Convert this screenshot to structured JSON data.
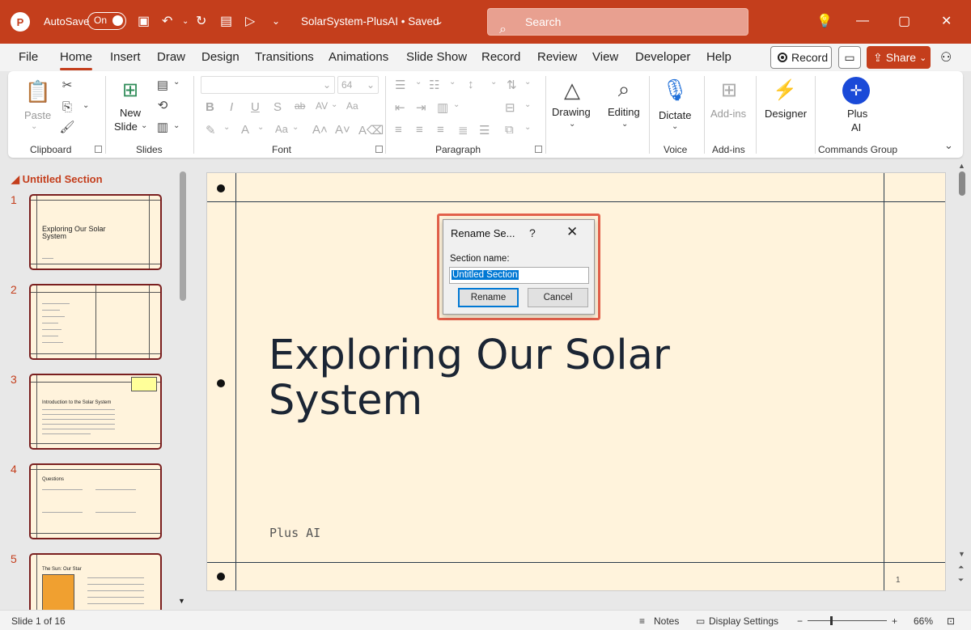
{
  "titlebar": {
    "app_logo": "P",
    "autosave_label": "AutoSave",
    "autosave_state": "On",
    "doc_title": "SolarSystem-PlusAI • Saved",
    "search_placeholder": "Search",
    "accent_color": "#c43e1c"
  },
  "menu": {
    "tabs": [
      "File",
      "Home",
      "Insert",
      "Draw",
      "Design",
      "Transitions",
      "Animations",
      "Slide Show",
      "Record",
      "Review",
      "View",
      "Developer",
      "Help"
    ],
    "active_tab": "Home",
    "record_label": "Record",
    "share_label": "Share"
  },
  "ribbon": {
    "clipboard": {
      "label": "Clipboard",
      "paste": "Paste"
    },
    "slides": {
      "label": "Slides",
      "new_slide_1": "New",
      "new_slide_2": "Slide"
    },
    "font": {
      "label": "Font",
      "font_name": "",
      "font_size": "64"
    },
    "paragraph": {
      "label": "Paragraph"
    },
    "drawing": {
      "label": "Drawing"
    },
    "editing": {
      "label": "Editing"
    },
    "voice": {
      "label": "Voice",
      "dictate": "Dictate"
    },
    "addins": {
      "label": "Add-ins",
      "button": "Add-ins"
    },
    "designer": {
      "label": "Designer"
    },
    "commands": {
      "label": "Commands Group",
      "plus_1": "Plus",
      "plus_2": "AI"
    }
  },
  "panel": {
    "section_name": "Untitled Section",
    "slides": [
      {
        "num": "1",
        "title": "Exploring Our Solar System"
      },
      {
        "num": "2",
        "title": ""
      },
      {
        "num": "3",
        "title": "Introduction to the Solar System"
      },
      {
        "num": "4",
        "title": "Questions"
      },
      {
        "num": "5",
        "title": "The Sun: Our Star"
      }
    ]
  },
  "slide": {
    "title_line1": "Exploring Our Solar",
    "title_line2": "System",
    "subtitle": "Plus AI",
    "page_number": "1"
  },
  "dialog": {
    "title": "Rename Se...",
    "help": "?",
    "close": "✕",
    "field_label": "Section name:",
    "field_value": "Untitled Section",
    "rename_label": "Rename",
    "cancel_label": "Cancel"
  },
  "status": {
    "slide_of": "Slide 1 of 16",
    "notes_label": "Notes",
    "display_label": "Display Settings",
    "zoom": "66%"
  }
}
